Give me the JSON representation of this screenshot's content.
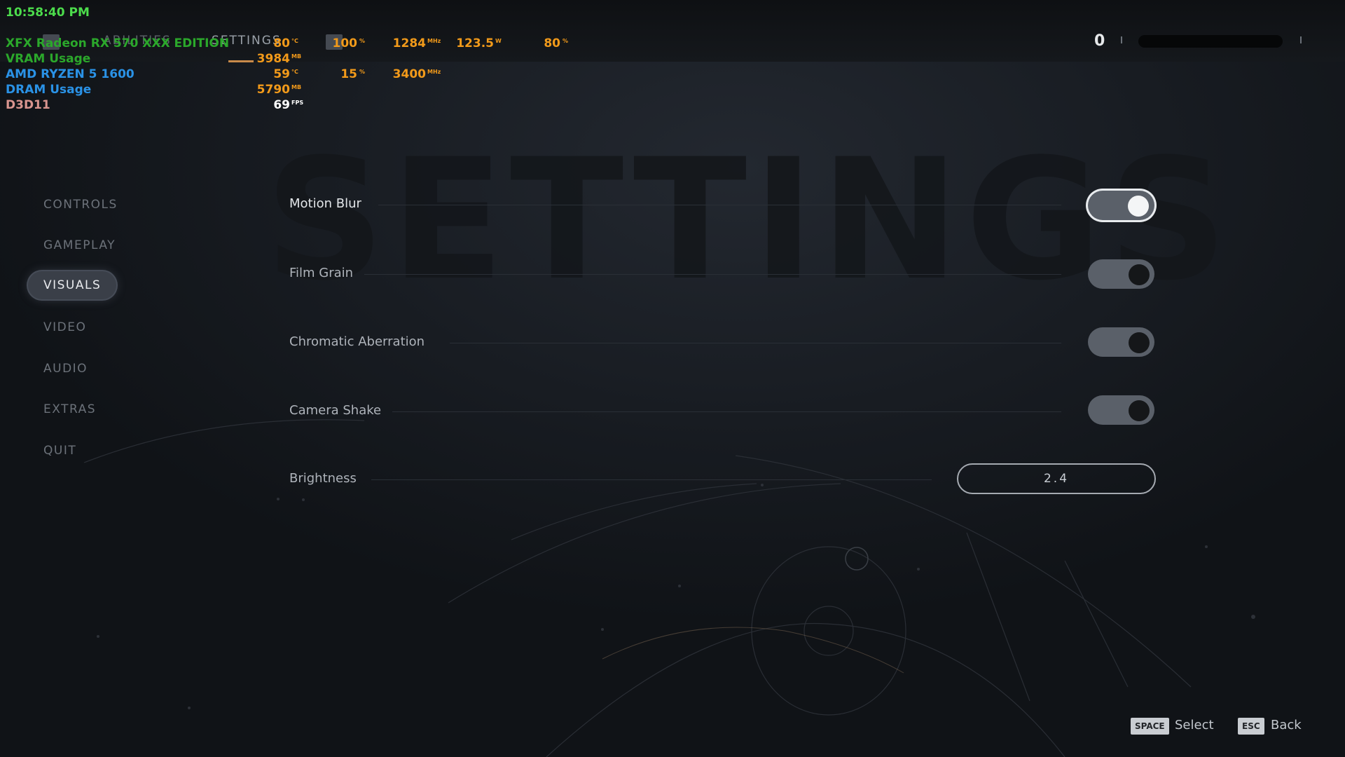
{
  "overlay": {
    "time": "10:58:40 PM",
    "gpu": {
      "label": "XFX Radeon RX 570 XXX EDITION",
      "temp": "80",
      "temp_unit": "°C",
      "usage": "100",
      "usage_unit": "%",
      "clock": "1284",
      "clock_unit": "MHz",
      "power": "123.5",
      "power_unit": "W",
      "fan": "80",
      "fan_unit": "%"
    },
    "vram": {
      "label": "VRAM Usage",
      "value": "3984",
      "unit": "MB"
    },
    "cpu": {
      "label": "AMD RYZEN 5 1600",
      "temp": "59",
      "temp_unit": "°C",
      "usage": "15",
      "usage_unit": "%",
      "clock": "3400",
      "clock_unit": "MHz"
    },
    "dram": {
      "label": "DRAM Usage",
      "value": "5790",
      "unit": "MB"
    },
    "api": {
      "label": "D3D11",
      "fps": "69",
      "fps_unit": "FPS"
    }
  },
  "topbar": {
    "tabs": [
      {
        "label": "ABILITIES"
      },
      {
        "label": "SETTINGS"
      }
    ],
    "currency": "0"
  },
  "watermark": "SETTINGS",
  "menu": {
    "items": [
      {
        "label": "CONTROLS"
      },
      {
        "label": "GAMEPLAY"
      },
      {
        "label": "VISUALS"
      },
      {
        "label": "VIDEO"
      },
      {
        "label": "AUDIO"
      },
      {
        "label": "EXTRAS"
      },
      {
        "label": "QUIT"
      }
    ],
    "active_index": 2
  },
  "settings": {
    "rows": [
      {
        "label": "Motion Blur",
        "type": "toggle",
        "on": true
      },
      {
        "label": "Film Grain",
        "type": "toggle",
        "on": false
      },
      {
        "label": "Chromatic Aberration",
        "type": "toggle",
        "on": false
      },
      {
        "label": "Camera Shake",
        "type": "toggle",
        "on": false
      },
      {
        "label": "Brightness",
        "type": "slider",
        "value": "2.4"
      }
    ]
  },
  "prompts": {
    "select": {
      "key": "SPACE",
      "label": "Select"
    },
    "back": {
      "key": "ESC",
      "label": "Back"
    }
  },
  "colors": {
    "accent": "#e8ebee",
    "toggle_track": "#5a6069",
    "hud_green": "#2ba82b",
    "hud_blue": "#2a92e6",
    "hud_orange": "#f29a1a"
  }
}
